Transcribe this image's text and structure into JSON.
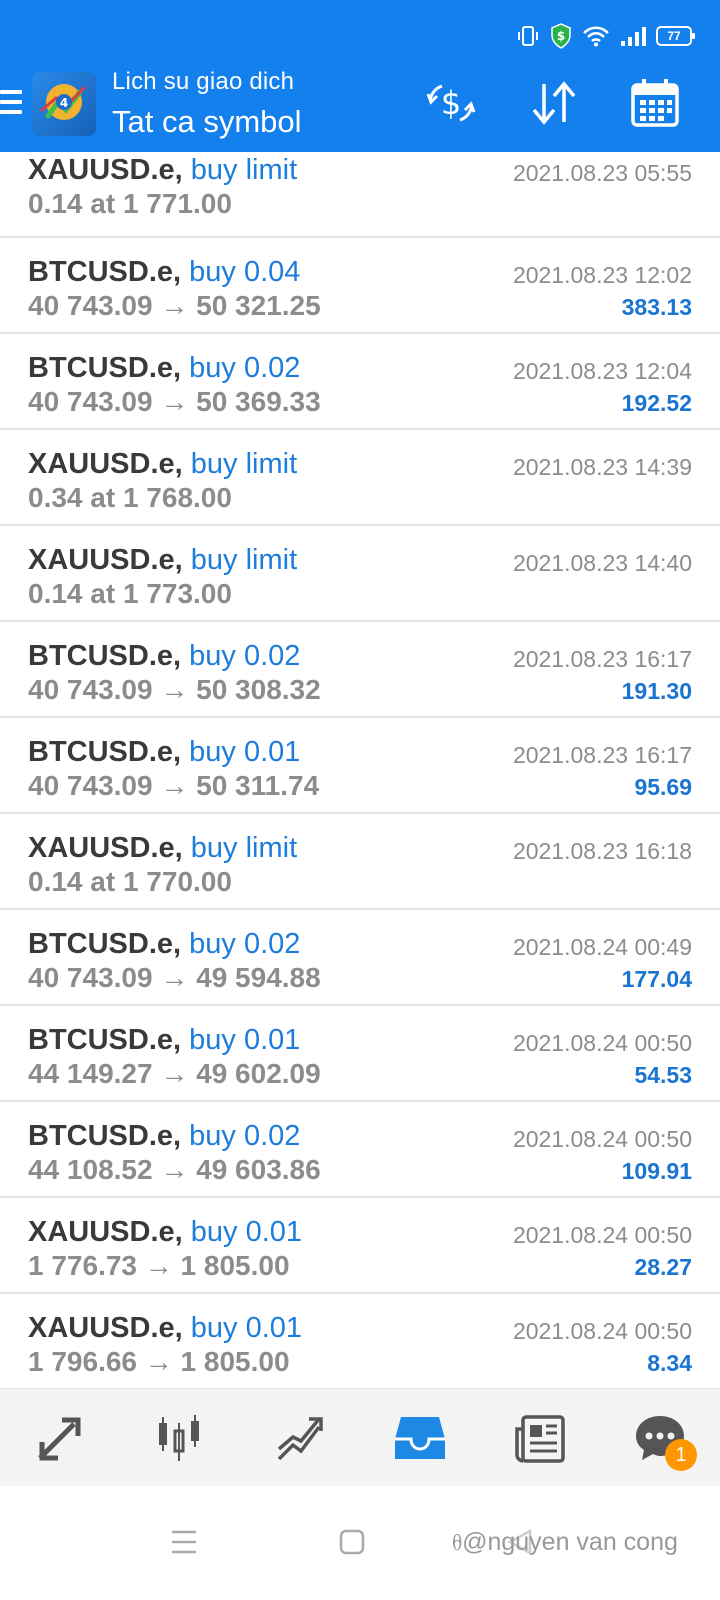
{
  "status_bar": {
    "battery": "77"
  },
  "header": {
    "title": "Lich su giao dich",
    "subtitle": "Tat ca symbol"
  },
  "orders": [
    {
      "symbol": "XAUUSD.e,",
      "type": "buy limit",
      "price": "0.14 at 1 771.00",
      "time": "2021.08.23 05:55",
      "profit": ""
    },
    {
      "symbol": "BTCUSD.e,",
      "type": "buy 0.04",
      "price": "40 743.09 → 50 321.25",
      "time": "2021.08.23 12:02",
      "profit": "383.13"
    },
    {
      "symbol": "BTCUSD.e,",
      "type": "buy 0.02",
      "price": "40 743.09 → 50 369.33",
      "time": "2021.08.23 12:04",
      "profit": "192.52"
    },
    {
      "symbol": "XAUUSD.e,",
      "type": "buy limit",
      "price": "0.34 at 1 768.00",
      "time": "2021.08.23 14:39",
      "profit": ""
    },
    {
      "symbol": "XAUUSD.e,",
      "type": "buy limit",
      "price": "0.14 at 1 773.00",
      "time": "2021.08.23 14:40",
      "profit": ""
    },
    {
      "symbol": "BTCUSD.e,",
      "type": "buy 0.02",
      "price": "40 743.09 → 50 308.32",
      "time": "2021.08.23 16:17",
      "profit": "191.30"
    },
    {
      "symbol": "BTCUSD.e,",
      "type": "buy 0.01",
      "price": "40 743.09 → 50 311.74",
      "time": "2021.08.23 16:17",
      "profit": "95.69"
    },
    {
      "symbol": "XAUUSD.e,",
      "type": "buy limit",
      "price": "0.14 at 1 770.00",
      "time": "2021.08.23 16:18",
      "profit": ""
    },
    {
      "symbol": "BTCUSD.e,",
      "type": "buy 0.02",
      "price": "40 743.09 → 49 594.88",
      "time": "2021.08.24 00:49",
      "profit": "177.04"
    },
    {
      "symbol": "BTCUSD.e,",
      "type": "buy 0.01",
      "price": "44 149.27 → 49 602.09",
      "time": "2021.08.24 00:50",
      "profit": "54.53"
    },
    {
      "symbol": "BTCUSD.e,",
      "type": "buy 0.02",
      "price": "44 108.52 → 49 603.86",
      "time": "2021.08.24 00:50",
      "profit": "109.91"
    },
    {
      "symbol": "XAUUSD.e,",
      "type": "buy 0.01",
      "price": "1 776.73 → 1 805.00",
      "time": "2021.08.24 00:50",
      "profit": "28.27"
    },
    {
      "symbol": "XAUUSD.e,",
      "type": "buy 0.01",
      "price": "1 796.66 → 1 805.00",
      "time": "2021.08.24 00:50",
      "profit": "8.34"
    }
  ],
  "bottom_nav": {
    "active": "history",
    "items": [
      "quotes",
      "chart",
      "trade",
      "history",
      "news",
      "chat"
    ],
    "chat_badge": "1"
  },
  "watermark": "@nguyen van cong",
  "colors": {
    "header_bg": "#1480ee",
    "accent_blue": "#1c7ddc",
    "text_dark": "#3a3a3a",
    "text_gray": "#8c8c8c",
    "badge_orange": "#ff9800"
  }
}
